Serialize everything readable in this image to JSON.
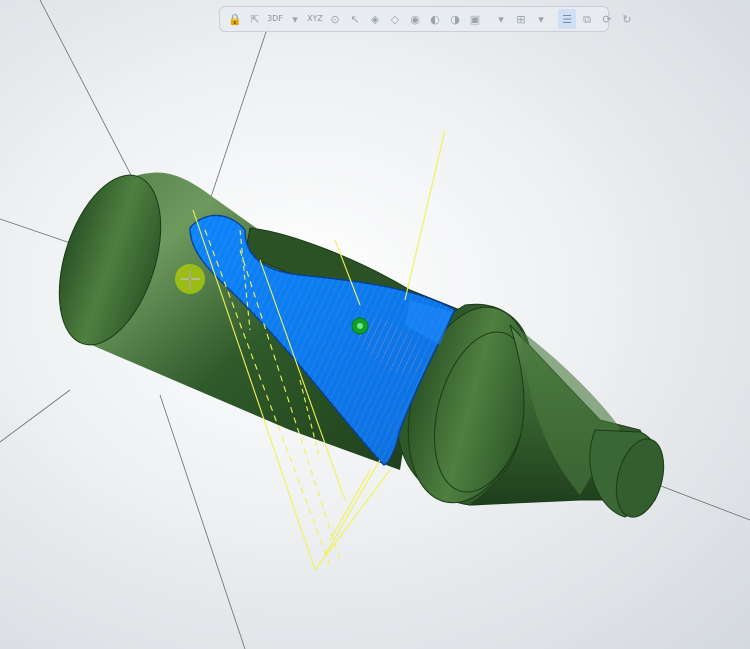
{
  "toolbar": {
    "items": [
      {
        "id": "lock",
        "glyph": "🔒"
      },
      {
        "id": "select-cursor",
        "glyph": "⇱"
      },
      {
        "id": "filter-label",
        "text": "3DF"
      },
      {
        "id": "caret1",
        "glyph": "▾"
      },
      {
        "id": "xyz",
        "text": "XYZ"
      },
      {
        "id": "snap",
        "glyph": "⊙"
      },
      {
        "id": "cursor2",
        "glyph": "↖"
      },
      {
        "id": "view1",
        "glyph": "◈"
      },
      {
        "id": "view2",
        "glyph": "◇"
      },
      {
        "id": "view3",
        "glyph": "◉"
      },
      {
        "id": "view4",
        "glyph": "◐"
      },
      {
        "id": "view5",
        "glyph": "◑"
      },
      {
        "id": "view6",
        "glyph": "▣"
      },
      {
        "id": "caret2",
        "glyph": "▾"
      },
      {
        "id": "grid",
        "glyph": "⊞"
      },
      {
        "id": "caret3",
        "glyph": "▾"
      },
      {
        "id": "layers",
        "glyph": "☰"
      },
      {
        "id": "window",
        "glyph": "⧉"
      },
      {
        "id": "orbit",
        "glyph": "⟳"
      },
      {
        "id": "rotate",
        "glyph": "↻"
      }
    ]
  },
  "colors": {
    "part_green": "#2f5f2a",
    "part_highlight": "#6d9a5f",
    "machined_face": "#0b7bf0",
    "toolpath": "#e88c8c",
    "guide_yellow": "#f2f252",
    "axis_gray": "#6d6d6d",
    "marker_yellow": "#a8c70c",
    "marker_green": "#0fa12c"
  }
}
